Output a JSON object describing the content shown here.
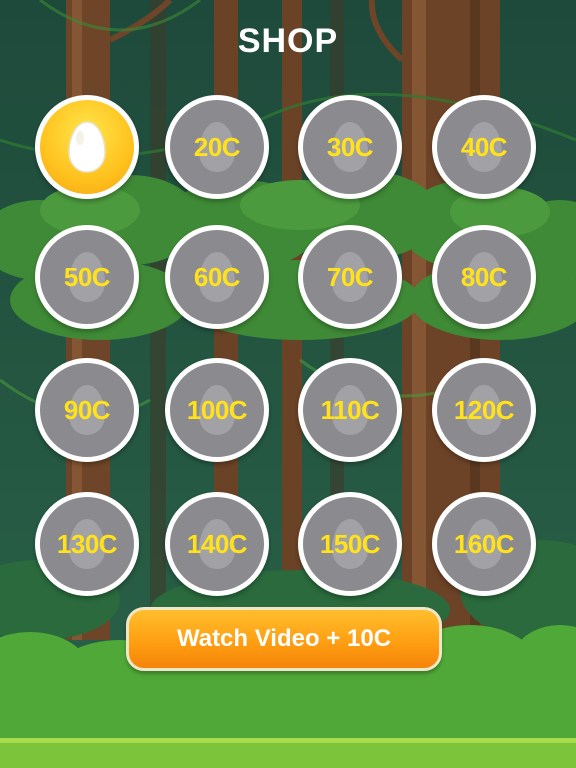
{
  "title": "SHOP",
  "watch_button": {
    "label": "Watch Video + 10C"
  },
  "items": [
    {
      "price": "",
      "selected": true
    },
    {
      "price": "20C",
      "selected": false
    },
    {
      "price": "30C",
      "selected": false
    },
    {
      "price": "40C",
      "selected": false
    },
    {
      "price": "50C",
      "selected": false
    },
    {
      "price": "60C",
      "selected": false
    },
    {
      "price": "70C",
      "selected": false
    },
    {
      "price": "80C",
      "selected": false
    },
    {
      "price": "90C",
      "selected": false
    },
    {
      "price": "100C",
      "selected": false
    },
    {
      "price": "110C",
      "selected": false
    },
    {
      "price": "120C",
      "selected": false
    },
    {
      "price": "130C",
      "selected": false
    },
    {
      "price": "140C",
      "selected": false
    },
    {
      "price": "150C",
      "selected": false
    },
    {
      "price": "160C",
      "selected": false
    }
  ],
  "colors": {
    "price_text": "#ffe21a",
    "locked_slot": "#8a8a8f",
    "selected_slot": "#ffc21e",
    "button": "#ff9f12"
  }
}
